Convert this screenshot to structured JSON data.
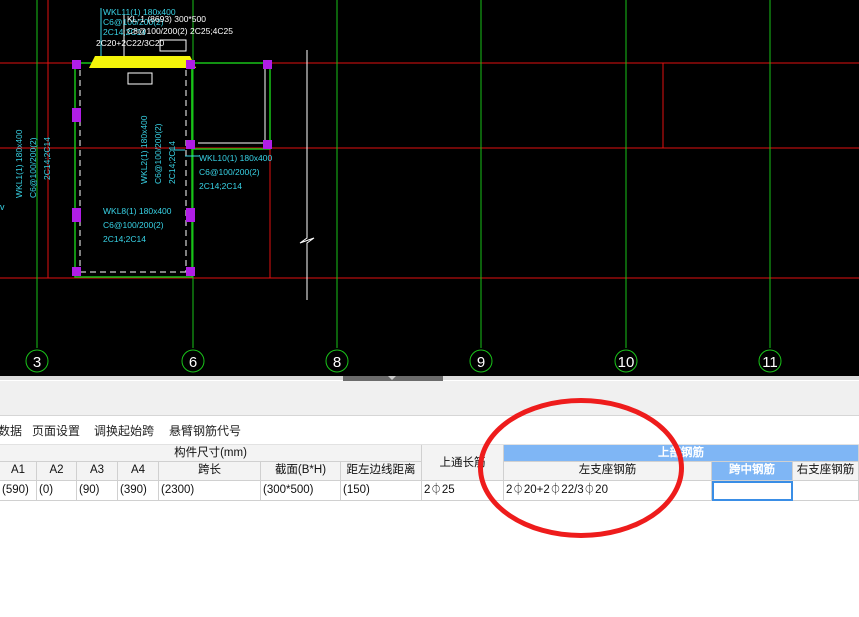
{
  "cad": {
    "axis_numbers": [
      "3",
      "6",
      "8",
      "9",
      "10",
      "11"
    ],
    "top_label_wkl11": [
      "WKL11(1) 180x400",
      "C6@100/200(2)",
      "2C14;2C14"
    ],
    "top_label_kl": [
      "KL-1 (8693) 300*500",
      "C8@100/200(2) 2C25;4C25",
      "2C20+2C22/3C20"
    ],
    "wkl1_label": [
      "WKL1(1) 180x400",
      "C6@100/200(2)",
      "2C14;2C14"
    ],
    "wkl2_label": [
      "WKL2(1) 180x400",
      "C6@100/200(2)",
      "2C14;2C14"
    ],
    "wkl10_label": [
      "WKL10(1) 180x400",
      "C6@100/200(2)",
      "2C14;2C14"
    ],
    "wkl8_label": [
      "WKL8(1) 180x400",
      "C6@100/200(2)",
      "2C14;2C14"
    ]
  },
  "toolbar": {
    "items": [
      "数据",
      "页面设置",
      "调换起始跨",
      "悬臂钢筋代号"
    ]
  },
  "table": {
    "group_dims": "构件尺寸(mm)",
    "top_through": "上通长筋",
    "group_top_rebar": "上部钢筋",
    "col_a1": "A1",
    "col_a2": "A2",
    "col_a3": "A3",
    "col_a4": "A4",
    "col_span": "跨长",
    "col_section": "截面(B*H)",
    "col_edge": "距左边线距离",
    "col_left_support": "左支座钢筋",
    "col_mid": "跨中钢筋",
    "col_right_support": "右支座钢筋",
    "row": {
      "a1": "(590)",
      "a2": "(0)",
      "a3": "(90)",
      "a4": "(390)",
      "span": "(2300)",
      "section": "(300*500)",
      "edge": "(150)",
      "top_through": "2⏀25",
      "left_support": "2⏀20+2⏀22/3⏀20",
      "mid": "",
      "right_support": ""
    }
  },
  "colors": {
    "cad_background": "#000000",
    "grid_red": "#e01010",
    "grid_green": "#19c219",
    "column_magenta": "#b01ee6",
    "label_cyan": "#38d3e6",
    "beam_yellow": "#f5f50a",
    "header_blue": "#7fb6f5",
    "annotation_red": "#ee1c1c"
  }
}
